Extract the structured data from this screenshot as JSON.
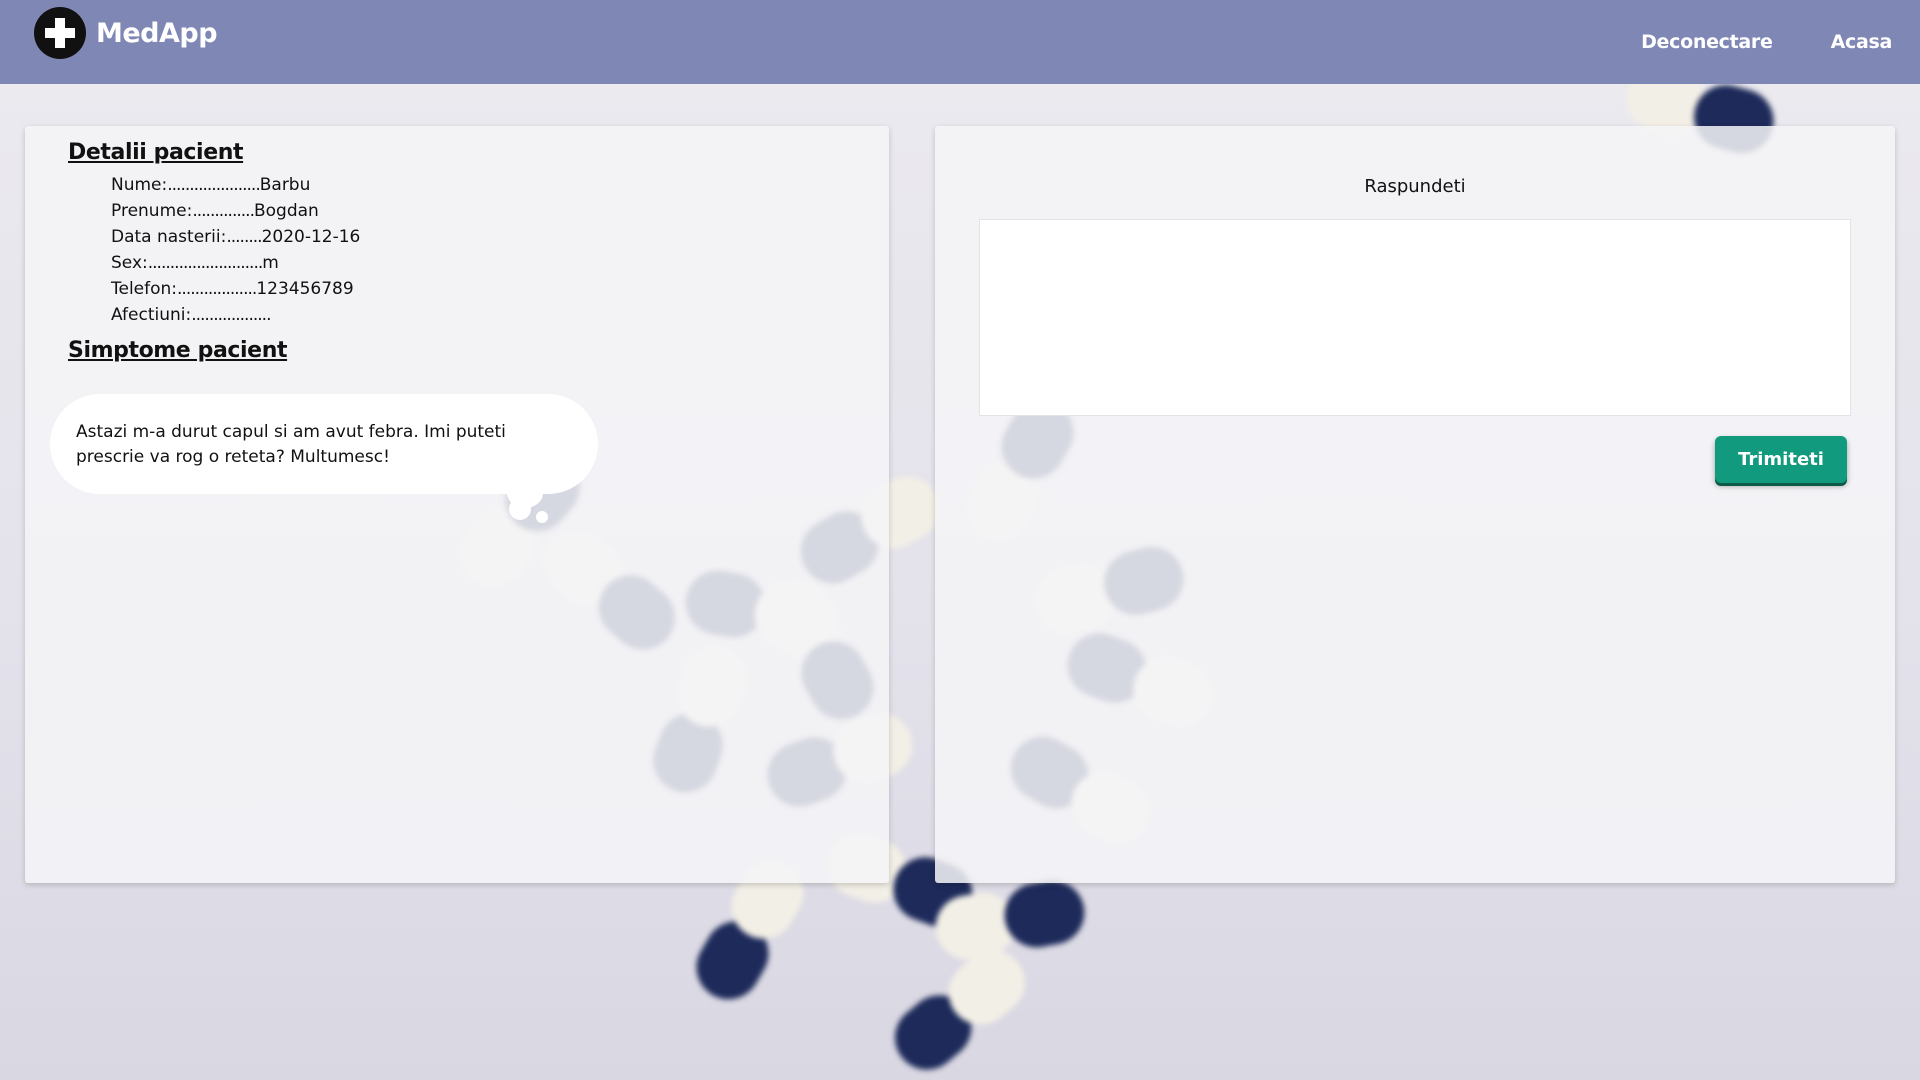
{
  "header": {
    "brand": "MedApp",
    "nav": {
      "logout": "Deconectare",
      "home": "Acasa"
    }
  },
  "patient": {
    "details_title": "Detalii pacient",
    "fields": [
      {
        "label": "Nume:",
        "dots": ".....................",
        "value": "Barbu"
      },
      {
        "label": "Prenume:",
        "dots": "..............",
        "value": "Bogdan"
      },
      {
        "label": "Data nasterii:",
        "dots": "........",
        "value": "2020-12-16"
      },
      {
        "label": "Sex:",
        "dots": "..........................",
        "value": "m"
      },
      {
        "label": "Telefon:",
        "dots": "..................",
        "value": "123456789"
      },
      {
        "label": "Afectiuni:",
        "dots": "..................",
        "value": ""
      }
    ],
    "symptoms_title": "Simptome pacient",
    "symptoms_text": "Astazi m-a durut capul si am avut febra. Imi puteti prescrie va rog o reteta? Multumesc!"
  },
  "reply": {
    "label": "Raspundeti",
    "value": "",
    "send_label": "Trimiteti"
  },
  "colors": {
    "header": "#7f87b5",
    "button": "#119a7d",
    "capsule_dark": "#1d2a5a",
    "capsule_light": "#f2efe6"
  }
}
